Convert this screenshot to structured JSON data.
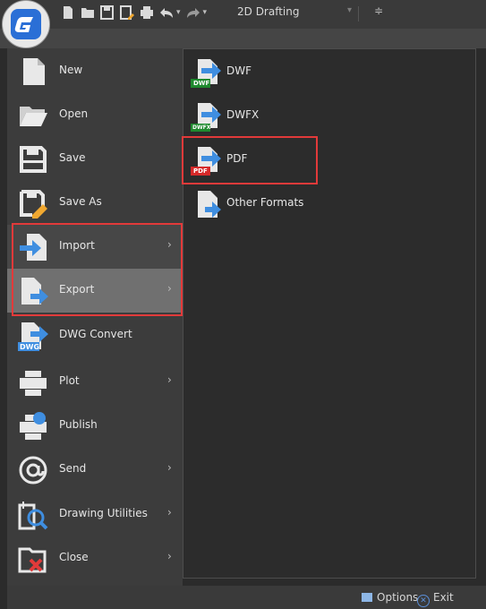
{
  "titlebar": {
    "workspace": "2D Drafting",
    "quick_access": [
      "new-icon",
      "open-icon",
      "save-icon",
      "save-as-icon",
      "plot-icon",
      "undo-icon",
      "redo-icon"
    ]
  },
  "menu": {
    "items": [
      {
        "label": "New",
        "icon": "new-icon",
        "submenu": false
      },
      {
        "label": "Open",
        "icon": "open-folder-icon",
        "submenu": false
      },
      {
        "label": "Save",
        "icon": "save-icon",
        "submenu": false
      },
      {
        "label": "Save As",
        "icon": "save-as-icon",
        "submenu": false
      },
      {
        "label": "Import",
        "icon": "import-icon",
        "submenu": true
      },
      {
        "label": "Export",
        "icon": "export-icon",
        "submenu": true
      },
      {
        "label": "DWG Convert",
        "icon": "dwg-convert-icon",
        "submenu": false
      },
      {
        "label": "Plot",
        "icon": "plot-icon",
        "submenu": true
      },
      {
        "label": "Publish",
        "icon": "publish-icon",
        "submenu": false
      },
      {
        "label": "Send",
        "icon": "send-icon",
        "submenu": true
      },
      {
        "label": "Drawing Utilities",
        "icon": "drawing-utilities-icon",
        "submenu": true
      },
      {
        "label": "Close",
        "icon": "close-icon",
        "submenu": true
      }
    ],
    "submenu_arrow": "›",
    "selected": "Export"
  },
  "export_submenu": {
    "items": [
      {
        "label": "DWF",
        "icon": "dwf-icon",
        "tag": "DWF"
      },
      {
        "label": "DWFX",
        "icon": "dwfx-icon",
        "tag": "DWFX"
      },
      {
        "label": "PDF",
        "icon": "pdf-icon",
        "tag": "PDF"
      },
      {
        "label": "Other Formats",
        "icon": "other-formats-icon",
        "tag": ""
      }
    ]
  },
  "bottom": {
    "options_label": "Options",
    "exit_label": "Exit"
  },
  "colors": {
    "accent_blue": "#3f8ee0",
    "highlight_red": "#e23a3a",
    "selected_bg": "#707070"
  }
}
